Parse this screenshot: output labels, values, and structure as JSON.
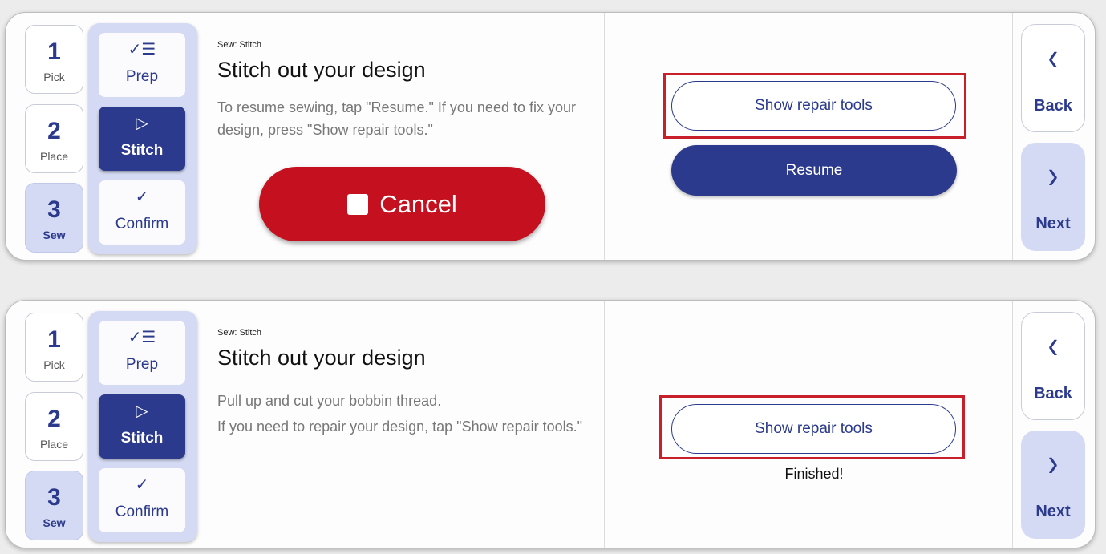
{
  "steps": [
    {
      "num": "1",
      "label": "Pick"
    },
    {
      "num": "2",
      "label": "Place"
    },
    {
      "num": "3",
      "label": "Sew"
    }
  ],
  "substeps": [
    {
      "icon": "checklist-icon",
      "glyph": "✓☰",
      "label": "Prep"
    },
    {
      "icon": "play-icon",
      "glyph": "▷",
      "label": "Stitch"
    },
    {
      "icon": "check-icon",
      "glyph": "✓",
      "label": "Confirm"
    }
  ],
  "nav": {
    "back_label": "Back",
    "next_label": "Next"
  },
  "panel1": {
    "crumb": "Sew: Stitch",
    "title": "Stitch out your design",
    "body": "To resume sewing, tap \"Resume.\" If you need to fix your design, press \"Show repair tools.\"",
    "cancel_label": "Cancel",
    "repair_label": "Show repair tools",
    "resume_label": "Resume"
  },
  "panel2": {
    "crumb": "Sew: Stitch",
    "title": "Stitch out your design",
    "body_line1": "Pull up and cut your bobbin thread.",
    "body_line2": "If you need to repair your design, tap \"Show repair tools.\"",
    "repair_label": "Show repair tools",
    "status": "Finished!"
  },
  "colors": {
    "accent": "#2b3a8c",
    "danger": "#c5111f",
    "highlight": "#c8202a",
    "active_bg": "#d4daf3"
  }
}
